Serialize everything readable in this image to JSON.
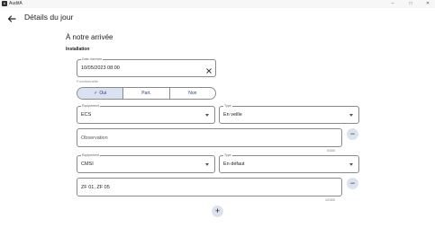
{
  "window": {
    "app_title": "AuditA",
    "minimize": "–",
    "maximize": "□",
    "close": "✕"
  },
  "header": {
    "title": "Détails du jour"
  },
  "section": {
    "title": "À notre arrivée",
    "group": "Installation"
  },
  "arrival_date": {
    "label": "Date d'arrivée",
    "value": "10/05/2023 08:00"
  },
  "functional": {
    "label": "Fonctionnelle",
    "options": [
      "Oui",
      "Part.",
      "Non"
    ],
    "selected": "Oui"
  },
  "equipments": [
    {
      "equipment_label": "Équipement",
      "equipment_value": "ECS",
      "type_label": "Type",
      "type_value": "En veille",
      "observation_placeholder": "Observation",
      "observation_value": "",
      "counter": "0/300"
    },
    {
      "equipment_label": "Équipement",
      "equipment_value": "CMSI",
      "type_label": "Type",
      "type_value": "En défaut",
      "observation_placeholder": "Observation",
      "observation_value": "ZF 01, ZF 05",
      "counter": "12/300"
    }
  ],
  "buttons": {
    "remove": "−",
    "add": "+"
  }
}
